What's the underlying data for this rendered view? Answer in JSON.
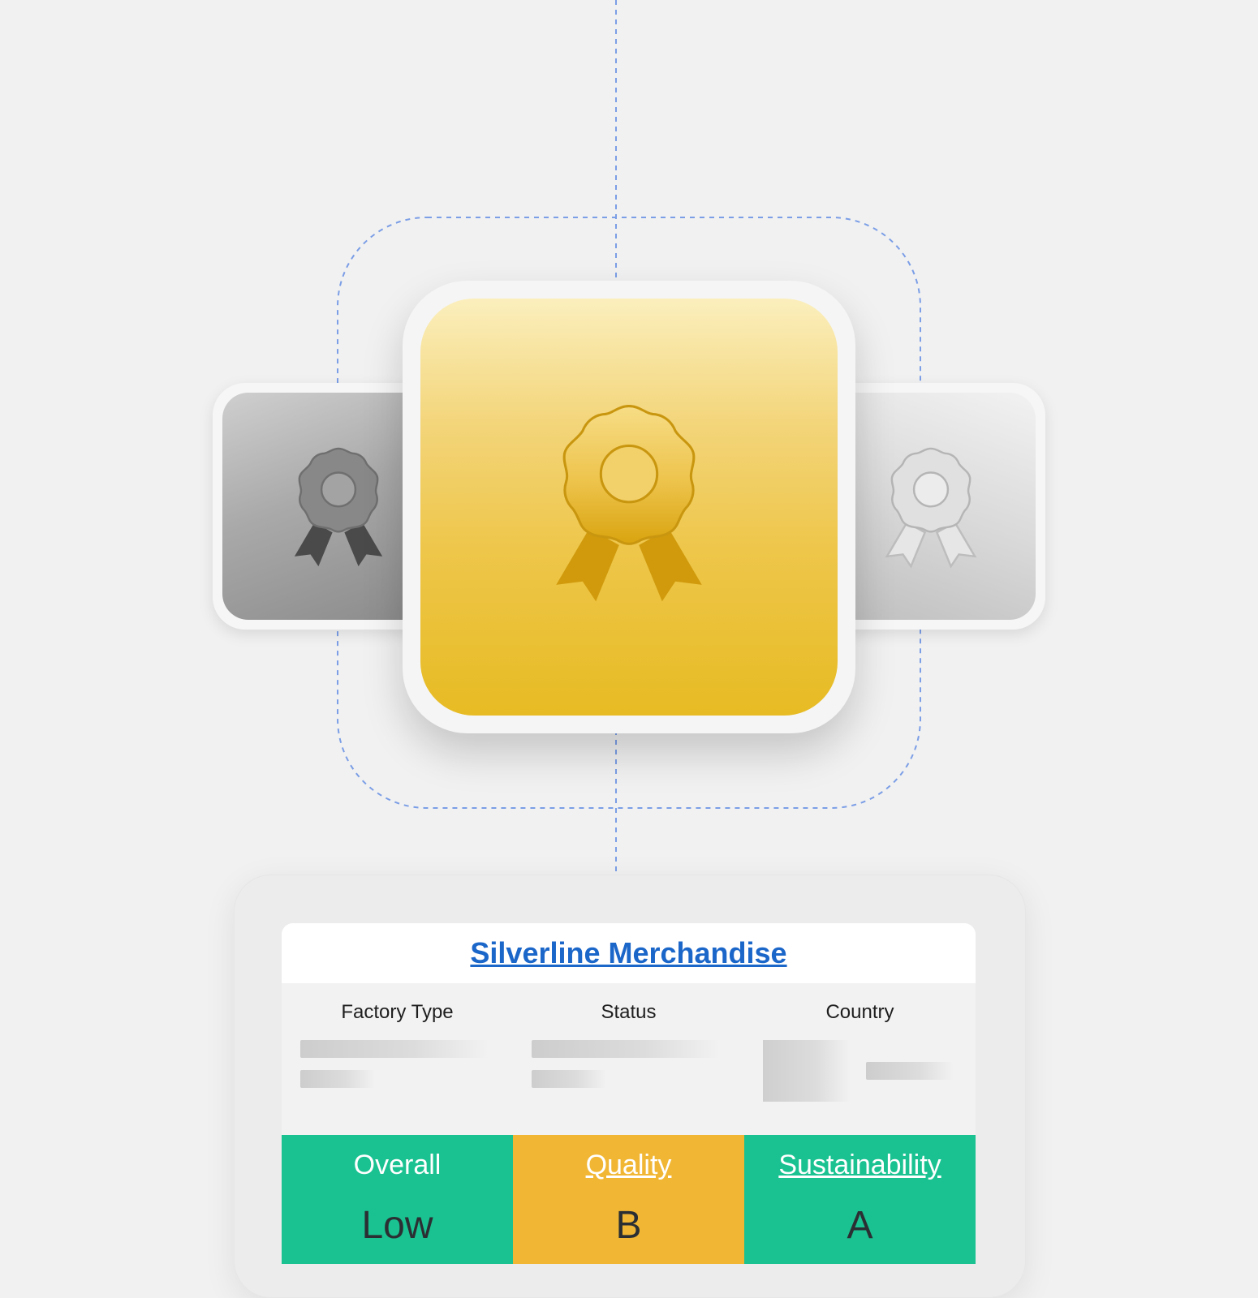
{
  "colors": {
    "background": "#f1f1f1",
    "guide_line": "#7b9ee6",
    "gold": "#e7bb23",
    "ribbon_gold": "#d09a0c",
    "link": "#1b66c9",
    "rating_green": "#1ac291",
    "rating_amber": "#f1b634"
  },
  "badges": {
    "left": {
      "icon": "award-ribbon-icon",
      "tone": "dark-gray"
    },
    "center": {
      "icon": "award-ribbon-icon",
      "tone": "gold"
    },
    "right": {
      "icon": "award-ribbon-icon",
      "tone": "light-silver"
    }
  },
  "card": {
    "title": "Silverline Merchandise",
    "columns": [
      {
        "label": "Factory Type"
      },
      {
        "label": "Status"
      },
      {
        "label": "Country"
      }
    ],
    "ratings": [
      {
        "label": "Overall",
        "value": "Low",
        "color": "#1ac291",
        "is_link": false
      },
      {
        "label": "Quality",
        "value": "B",
        "color": "#f1b634",
        "is_link": true
      },
      {
        "label": "Sustainability",
        "value": "A",
        "color": "#1ac291",
        "is_link": true
      }
    ]
  }
}
